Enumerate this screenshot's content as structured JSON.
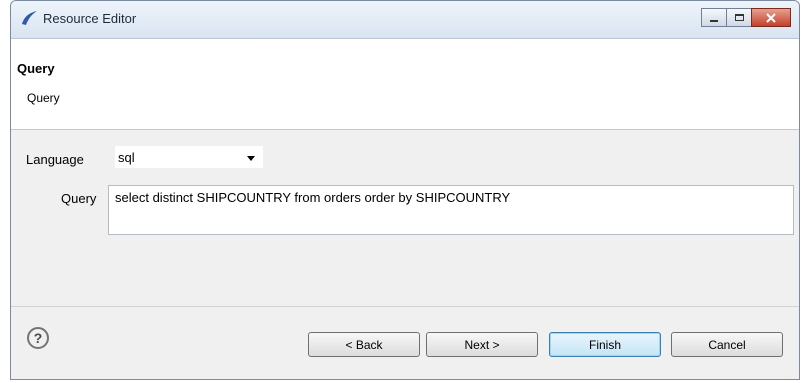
{
  "window": {
    "title": "Resource Editor"
  },
  "header": {
    "title": "Query",
    "description": "Query"
  },
  "form": {
    "language_label": "Language",
    "language_value": "sql",
    "query_label": "Query",
    "query_value": "select distinct SHIPCOUNTRY from orders order by SHIPCOUNTRY"
  },
  "footer": {
    "help_symbol": "?",
    "back_label": "< Back",
    "next_label": "Next >",
    "finish_label": "Finish",
    "cancel_label": "Cancel"
  },
  "icons": {
    "title": "eclipse-logo-icon",
    "minimize": "minimize-icon",
    "maximize": "maximize-icon",
    "close": "close-icon",
    "help": "help-icon",
    "dropdown": "chevron-down-icon"
  },
  "colors": {
    "accent": "#3c7fb1",
    "close": "#c3412b"
  }
}
